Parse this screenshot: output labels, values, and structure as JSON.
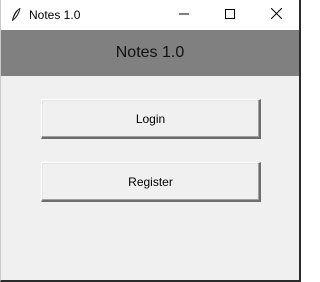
{
  "window": {
    "title": "Notes 1.0",
    "app_icon": "feather-icon",
    "controls": [
      "minimize-icon",
      "maximize-icon",
      "close-icon"
    ]
  },
  "header": {
    "title": "Notes 1.0",
    "background_color": "#808080"
  },
  "buttons": {
    "login_label": "Login",
    "register_label": "Register"
  }
}
